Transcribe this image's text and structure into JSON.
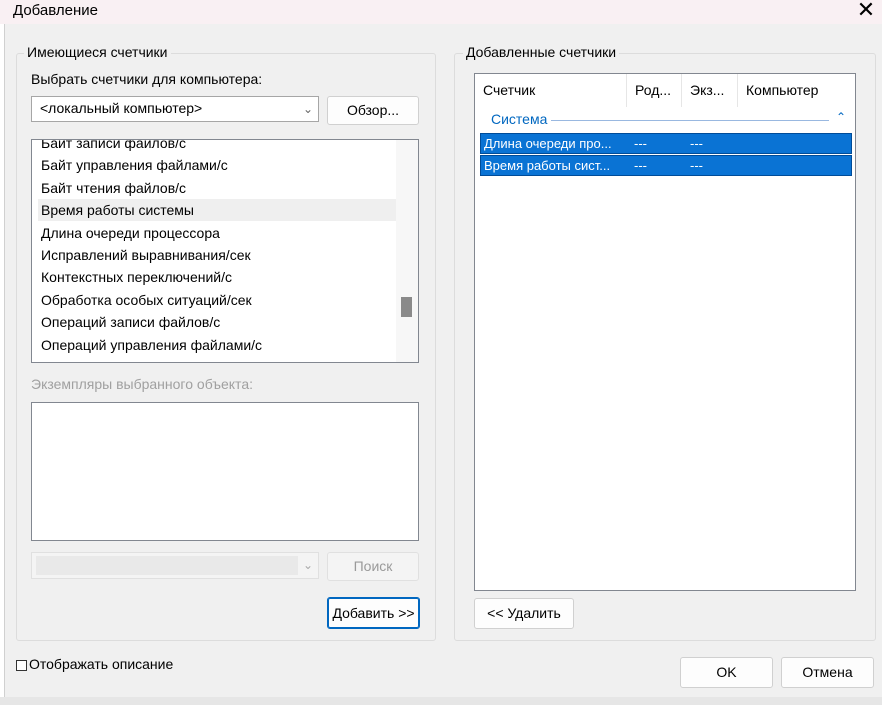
{
  "window": {
    "title": "Добавление",
    "close_icon": "close-icon"
  },
  "available": {
    "group_label": "Имеющиеся счетчики",
    "computer_label": "Выбрать счетчики для компьютера:",
    "computer_value": "<локальный компьютер>",
    "browse_label": "Обзор...",
    "counters": [
      "Байт записи файлов/с",
      "Байт управления файлами/с",
      "Байт чтения файлов/с",
      "Время работы системы",
      "Длина очереди процессора",
      "Исправлений выравнивания/сек",
      "Контекстных переключений/с",
      "Обработка особых ситуаций/сек",
      "Операций записи файлов/с",
      "Операций управления файлами/с"
    ],
    "highlighted_index": 3,
    "instances_label": "Экземпляры выбранного объекта:",
    "search_label": "Поиск",
    "add_label": "Добавить >>"
  },
  "added": {
    "group_label": "Добавленные счетчики",
    "columns": [
      "Счетчик",
      "Род...",
      "Экз...",
      "Компьютер"
    ],
    "group_name": "Система",
    "rows": [
      {
        "counter": "Длина очереди про...",
        "parent": "---",
        "instance": "---"
      },
      {
        "counter": "Время работы сист...",
        "parent": "---",
        "instance": "---"
      }
    ],
    "remove_label": "<< Удалить"
  },
  "footer": {
    "show_description_label": "Отображать описание",
    "show_description_checked": false,
    "ok_label": "OK",
    "cancel_label": "Отмена"
  },
  "colors": {
    "selection": "#0a73d4",
    "group_accent": "#0067c0"
  }
}
